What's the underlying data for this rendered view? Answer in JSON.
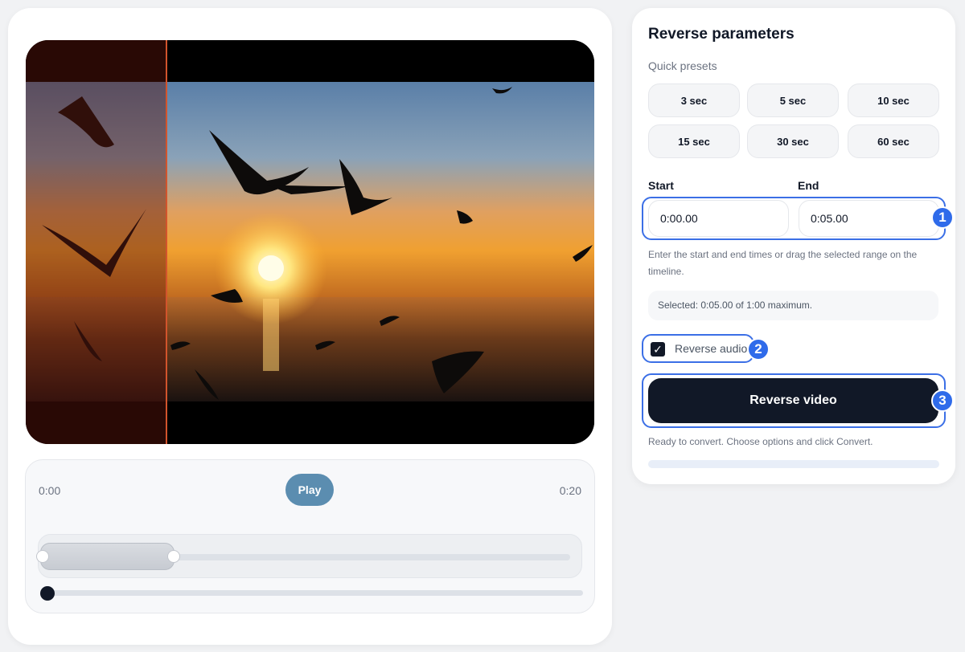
{
  "player": {
    "time_start": "0:00",
    "time_end": "0:20",
    "play_label": "Play"
  },
  "panel": {
    "title": "Reverse parameters",
    "presets_label": "Quick presets",
    "presets": [
      "3 sec",
      "5 sec",
      "10 sec",
      "15 sec",
      "30 sec",
      "60 sec"
    ],
    "start_label": "Start",
    "end_label": "End",
    "start_value": "0:00.00",
    "end_value": "0:05.00",
    "hint": "Enter the start and end times or drag the selected range on the timeline.",
    "selected_info": "Selected: 0:05.00 of 1:00 maximum.",
    "reverse_audio_label": "Reverse audio",
    "reverse_audio_checked": true,
    "reverse_button": "Reverse video",
    "status": "Ready to convert. Choose options and click Convert.",
    "progress": 0
  },
  "annotations": [
    "1",
    "2",
    "3"
  ],
  "colors": {
    "accent": "#3b6fe6",
    "primary_button": "#111827",
    "play_button": "#5b8db0"
  }
}
